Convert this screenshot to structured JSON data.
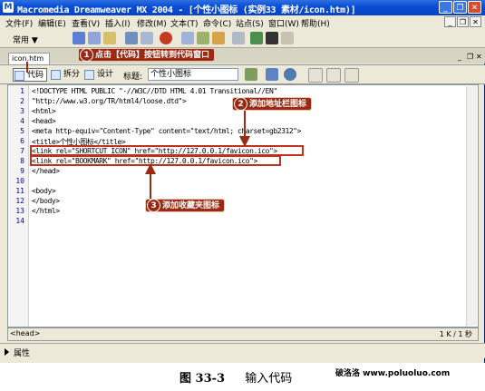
{
  "window": {
    "title": "Macromedia Dreamweaver MX 2004 - [个性小图标 (实例33  素材/icon.htm)]",
    "app_icon": "dreamweaver-icon",
    "controls": [
      "minimize-icon",
      "restore-icon",
      "close-icon"
    ]
  },
  "menubar": {
    "items": [
      "文件(F)",
      "编辑(E)",
      "查看(V)",
      "插入(I)",
      "修改(M)",
      "文本(T)",
      "命令(C)",
      "站点(S)",
      "窗口(W)",
      "帮助(H)"
    ]
  },
  "insert_bar": {
    "category": "常用 ▼"
  },
  "document": {
    "tab": "icon.htm",
    "buttons": {
      "code": "代码",
      "split": "拆分",
      "design": "设计"
    },
    "title_label": "标题:",
    "title_value": "个性小图标"
  },
  "code": {
    "line_numbers": [
      "1",
      "2",
      "3",
      "4",
      "5",
      "6",
      "7",
      "8",
      "9",
      "10",
      "11",
      "12",
      "13",
      "14"
    ],
    "lines": [
      "<!DOCTYPE HTML PUBLIC \"-//W3C//DTD HTML 4.01 Transitional//EN\"",
      "\"http://www.w3.org/TR/html4/loose.dtd\">",
      "<html>",
      "<head>",
      "<meta http-equiv=\"Content-Type\" content=\"text/html; charset=gb2312\">",
      "<title>个性小图标</title>",
      "<link rel=\"SHORTCUT ICON\" href=\"http://127.0.0.1/favicon.ico\">",
      "<link rel=\"BOOKMARK\" href=\"http://127.0.0.1/favicon.ico\">",
      "</head>",
      "",
      "<body>",
      "</body>",
      "</html>"
    ]
  },
  "status": {
    "tag": "<head>",
    "right": "1 K / 1 秒"
  },
  "properties": {
    "label": "属性"
  },
  "callouts": [
    {
      "num": "1",
      "text": "点击【代码】按钮转到代码窗口"
    },
    {
      "num": "2",
      "text": "添加地址栏图标"
    },
    {
      "num": "3",
      "text": "添加收藏夹图标"
    }
  ],
  "caption": {
    "figure": "图 33-3",
    "text": "输入代码"
  },
  "watermark": "破洛洛 www.poluoluo.com",
  "colors": {
    "callout": "#9a2a13",
    "highlight": "#c0311d",
    "titlebar": "#0a4fd6"
  }
}
